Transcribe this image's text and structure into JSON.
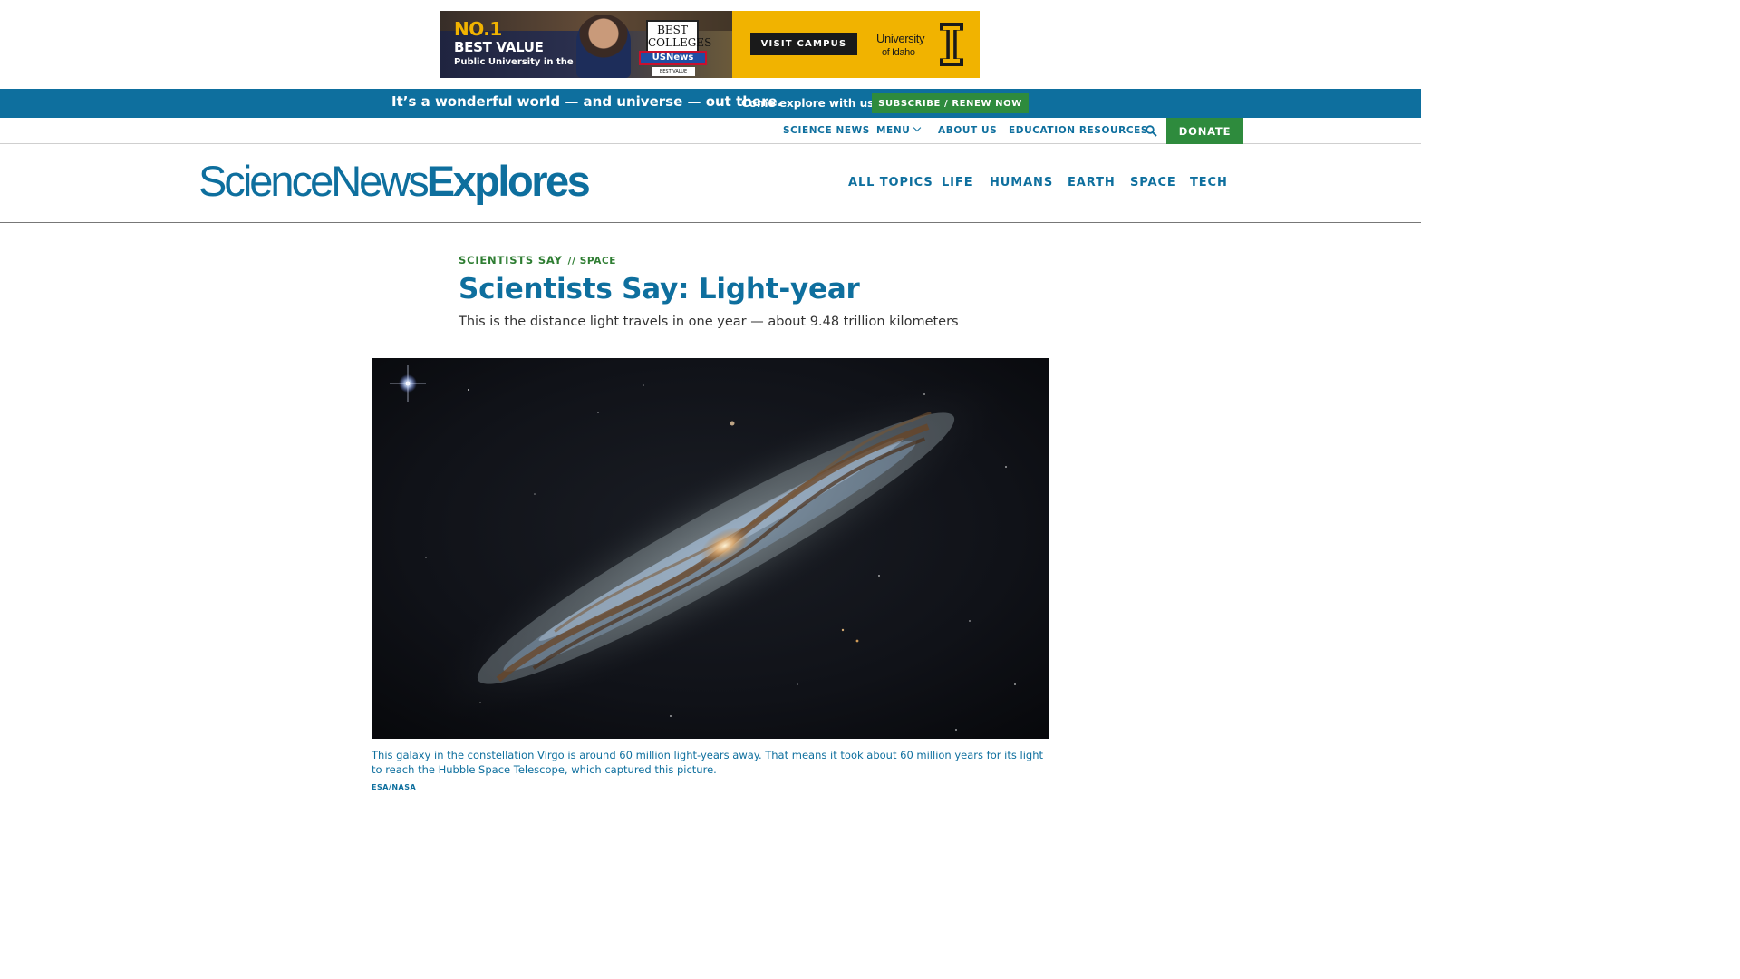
{
  "ad": {
    "headline_no1": "NO.1",
    "headline_best": "BEST VALUE",
    "headline_sub": "Public University in the West.",
    "badge_line1": "BEST",
    "badge_line2": "COLLEGES",
    "badge_brand": "USNews",
    "badge_footer": "BEST VALUE SCHOOLS",
    "cta_label": "VISIT CAMPUS",
    "university_line1": "University",
    "university_line2": "of Idaho",
    "accent_color": "#f1b300"
  },
  "promo": {
    "main_text": "It’s a wonderful world — and universe — out there.",
    "sub_text": "Come explore with us!",
    "button_label": "SUBSCRIBE / RENEW NOW",
    "background_color": "#0e6f9e"
  },
  "utility_nav": {
    "science_news": "SCIENCE NEWS",
    "menu": "MENU",
    "about_us": "ABOUT US",
    "education_resources": "EDUCATION RESOURCES",
    "search_icon": "search-icon",
    "donate": "DONATE"
  },
  "header": {
    "logo_part1": "ScienceNews",
    "logo_part2": "Explores",
    "nav": [
      "ALL TOPICS",
      "LIFE",
      "HUMANS",
      "EARTH",
      "SPACE",
      "TECH"
    ]
  },
  "article": {
    "kicker_series": "SCIENTISTS SAY",
    "kicker_topic": "// SPACE",
    "title": "Scientists Say: Light-year",
    "dek": "This is the distance light travels in one year — about 9.48 trillion kilometers",
    "caption": "This galaxy in the constellation Virgo is around 60 million light-years away. That means it took about 60 million years for its light to reach the Hubble Space Telescope, which captured this picture.",
    "credit": "ESA/NASA"
  }
}
